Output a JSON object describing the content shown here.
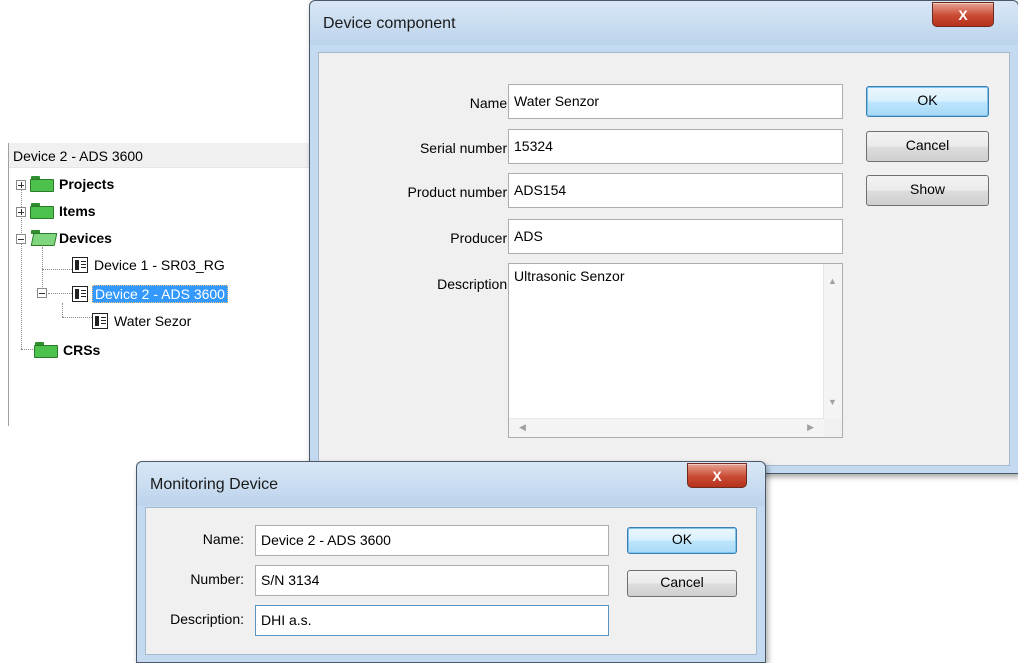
{
  "tree": {
    "header": "Device 2  - ADS 3600",
    "nodes": {
      "projects": "Projects",
      "items": "Items",
      "devices": "Devices",
      "device1": "Device 1 - SR03_RG",
      "device2": "Device 2  - ADS 3600",
      "water_sezor": "Water Sezor",
      "crss": "CRSs"
    },
    "selected": "Device 2  - ADS 3600"
  },
  "device_component": {
    "title": "Device component",
    "close": "X",
    "fields": {
      "name_label": "Name:",
      "name_value": "Water Senzor",
      "serial_label": "Serial number:",
      "serial_value": "15324",
      "product_label": "Product number:",
      "product_value": "ADS154",
      "producer_label": "Producer:",
      "producer_value": "ADS",
      "description_label": "Description:",
      "description_value": "Ultrasonic Senzor"
    },
    "buttons": {
      "ok": "OK",
      "cancel": "Cancel",
      "show": "Show"
    }
  },
  "monitoring_device": {
    "title": "Monitoring Device",
    "close": "X",
    "fields": {
      "name_label": "Name:",
      "name_value": "Device 2  - ADS 3600",
      "number_label": "Number:",
      "number_value": "S/N 3134",
      "description_label": "Description:",
      "description_value": "DHI a.s."
    },
    "buttons": {
      "ok": "OK",
      "cancel": "Cancel"
    }
  },
  "icons": {
    "folder": "folder-icon",
    "device": "device-icon",
    "expand": "plus-box-icon",
    "collapse": "minus-box-icon"
  },
  "colors": {
    "selection": "#3399ff",
    "folder_green": "#4cc24c",
    "close_red": "#c94a33",
    "dialog_frame": "#c4daf0"
  }
}
